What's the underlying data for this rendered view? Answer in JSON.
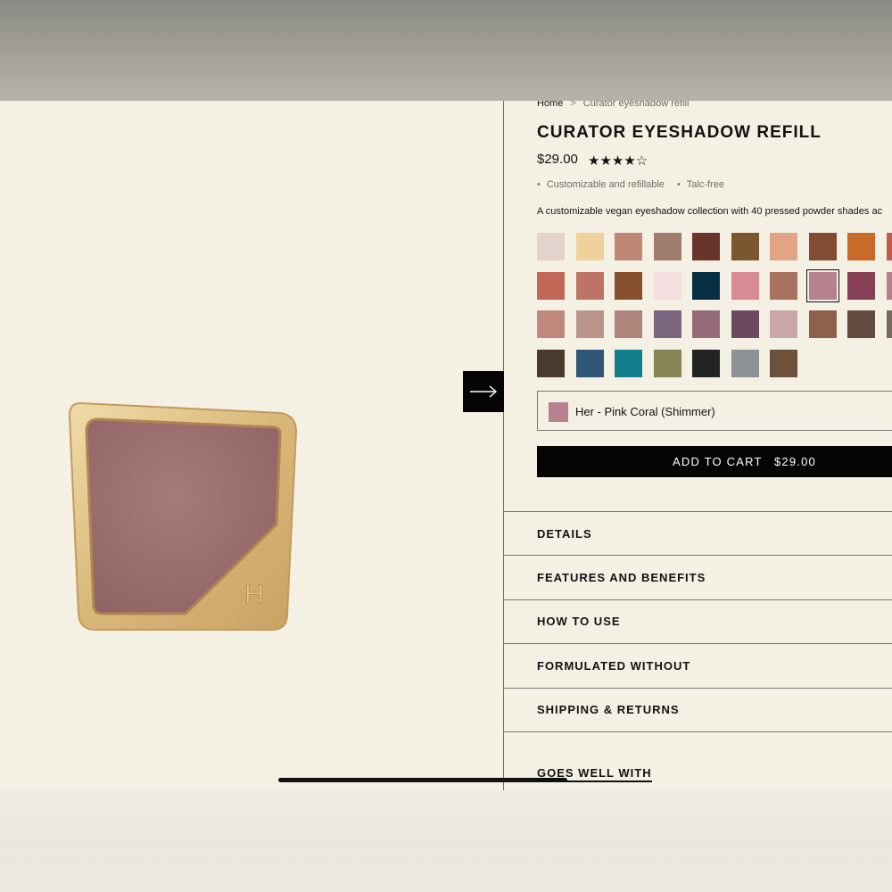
{
  "breadcrumb": {
    "home": "Home",
    "separator": ">",
    "current": "Curator eyeshadow refill"
  },
  "product": {
    "title": "CURATOR EYESHADOW REFILL",
    "price": "$29.00",
    "rating": 4.5,
    "stars_text": "★★★★☆",
    "features": [
      "Customizable and refillable",
      "Talc-free"
    ],
    "description": "A customizable vegan eyeshadow collection with  40 pressed powder shades ac"
  },
  "swatches": [
    {
      "color": "#e4d3cd"
    },
    {
      "color": "#f0d09b"
    },
    {
      "color": "#c08676"
    },
    {
      "color": "#a07c6f"
    },
    {
      "color": "#69342a"
    },
    {
      "color": "#7b5730"
    },
    {
      "color": "#e3a486"
    },
    {
      "color": "#834a34"
    },
    {
      "color": "#c9692a"
    },
    {
      "color": "#b95f47"
    },
    {
      "color": "#c2685a"
    },
    {
      "color": "#bd7466"
    },
    {
      "color": "#87512d"
    },
    {
      "color": "#f4dfe0"
    },
    {
      "color": "#072f44"
    },
    {
      "color": "#d78b97"
    },
    {
      "color": "#a8725f"
    },
    {
      "color": "#b8818f",
      "selected": true
    },
    {
      "color": "#863f55"
    },
    {
      "color": "#b97e8d"
    },
    {
      "color": "#bf887c"
    },
    {
      "color": "#bb948a"
    },
    {
      "color": "#ae857a"
    },
    {
      "color": "#7d6680"
    },
    {
      "color": "#956b78"
    },
    {
      "color": "#6b4a61"
    },
    {
      "color": "#c9a6a8"
    },
    {
      "color": "#8c634a"
    },
    {
      "color": "#634c3f"
    },
    {
      "color": "#7a6a5e"
    },
    {
      "color": "#4a3a2e"
    },
    {
      "color": "#2f5675"
    },
    {
      "color": "#137f8d"
    },
    {
      "color": "#868356"
    },
    {
      "color": "#222424"
    },
    {
      "color": "#8c9196"
    },
    {
      "color": "#6e513d"
    }
  ],
  "selected_shade": {
    "label": "Her - Pink Coral (Shimmer)",
    "color": "#b8818f"
  },
  "cart": {
    "label": "ADD TO CART",
    "price": "$29.00"
  },
  "accordion": [
    "DETAILS",
    "FEATURES AND BENEFITS",
    "HOW TO USE",
    "FORMULATED WITHOUT",
    "SHIPPING & RETURNS"
  ],
  "related": {
    "label": "GOES WELL WITH"
  }
}
